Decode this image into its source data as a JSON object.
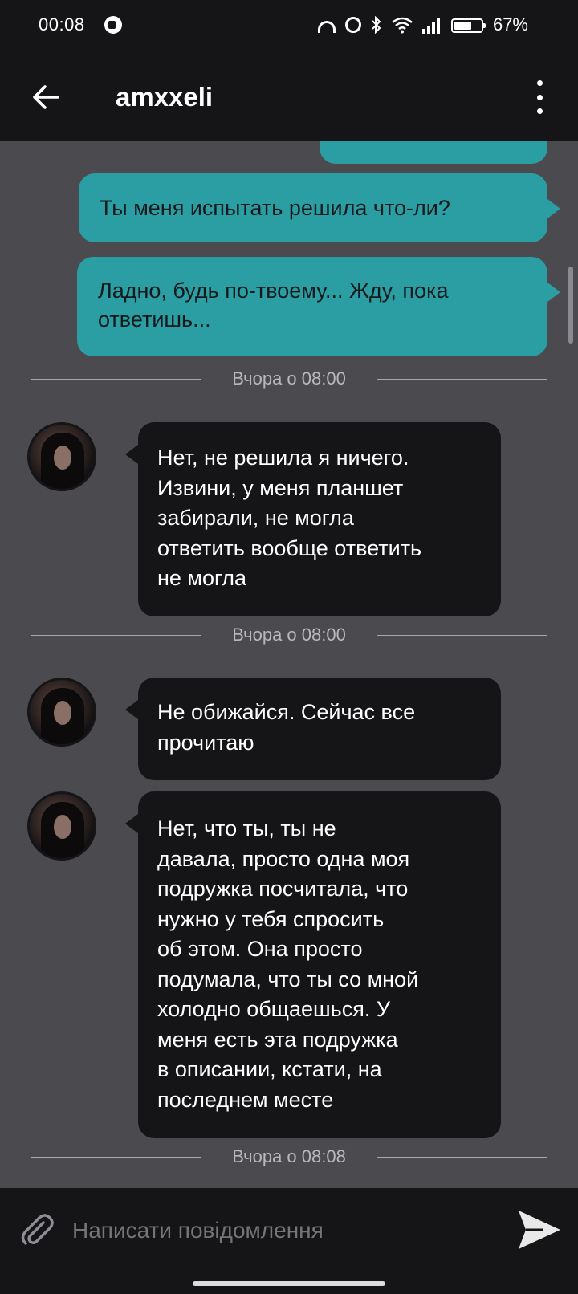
{
  "status_bar": {
    "time": "00:08",
    "battery_percent": "67%",
    "battery_level": 0.67,
    "icons": [
      "notification-icon",
      "headphones-icon",
      "alarm-icon",
      "bluetooth-icon",
      "wifi-icon",
      "signal-icon",
      "battery-icon"
    ]
  },
  "header": {
    "title": "amxxeli",
    "back_icon": "arrow-left-icon",
    "menu_icon": "more-vert-icon"
  },
  "messages": {
    "out1": "Ты меня испытать решила что-ли?",
    "out2_line1": "Ладно, будь по-твоему... Жду, пока",
    "out2_line2": "ответишь...",
    "sep1": "Вчора о 08:00",
    "in1_lines": [
      "Нет, не решила я ничего.",
      "Извини, у меня планшет",
      "забирали, не могла",
      "ответить вообще ответить",
      "не могла"
    ],
    "sep2": "Вчора о 08:00",
    "in2_lines": [
      "Не обижайся. Сейчас все",
      "прочитаю"
    ],
    "in3_lines": [
      "Нет, что ты, ты не",
      "давала, просто одна моя",
      "подружка посчитала, что",
      "нужно у тебя спросить",
      "об этом. Она просто",
      "подумала, что ты со мной",
      "холодно общаешься. У",
      "меня есть эта подружка",
      "в описании, кстати, на",
      "последнем месте"
    ],
    "sep3": "Вчора о 08:08"
  },
  "composer": {
    "placeholder": "Написати повідомлення",
    "attach_icon": "paperclip-icon",
    "send_icon": "send-icon"
  },
  "colors": {
    "outgoing_bubble": "#2a9ea3",
    "incoming_bubble": "#151417",
    "chat_background": "#4b4a4f",
    "bars": "#151417"
  }
}
